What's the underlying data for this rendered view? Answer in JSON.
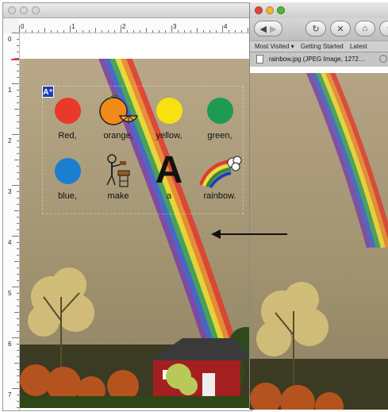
{
  "editor": {
    "ruler_h_numbers": [
      "0",
      "1",
      "2",
      "3",
      "4"
    ],
    "ruler_v_numbers": [
      "0",
      "1",
      "2",
      "3",
      "4",
      "5",
      "6",
      "7"
    ],
    "badge_text": "A⁺",
    "symbols": [
      {
        "label": "Red,",
        "kind": "dot",
        "color": "#e8392b"
      },
      {
        "label": "orange,",
        "kind": "orange-icon"
      },
      {
        "label": "yellow,",
        "kind": "dot",
        "color": "#f9e110"
      },
      {
        "label": "green,",
        "kind": "dot",
        "color": "#1f9a53"
      },
      {
        "label": "blue,",
        "kind": "dot",
        "color": "#1a7fd0"
      },
      {
        "label": "make",
        "kind": "make-icon"
      },
      {
        "label": "a",
        "kind": "letter-icon",
        "glyph": "A"
      },
      {
        "label": "rainbow.",
        "kind": "rainbow-icon"
      }
    ]
  },
  "browser": {
    "bookmarks": [
      "Most Visited ▾",
      "Getting Started",
      "Latest"
    ],
    "tab_title": "rainbow.jpg (JPEG Image, 1272…"
  },
  "colors": {
    "sky": "#a59478",
    "barn": "#a41f1f",
    "roof": "#3a3a3a"
  }
}
